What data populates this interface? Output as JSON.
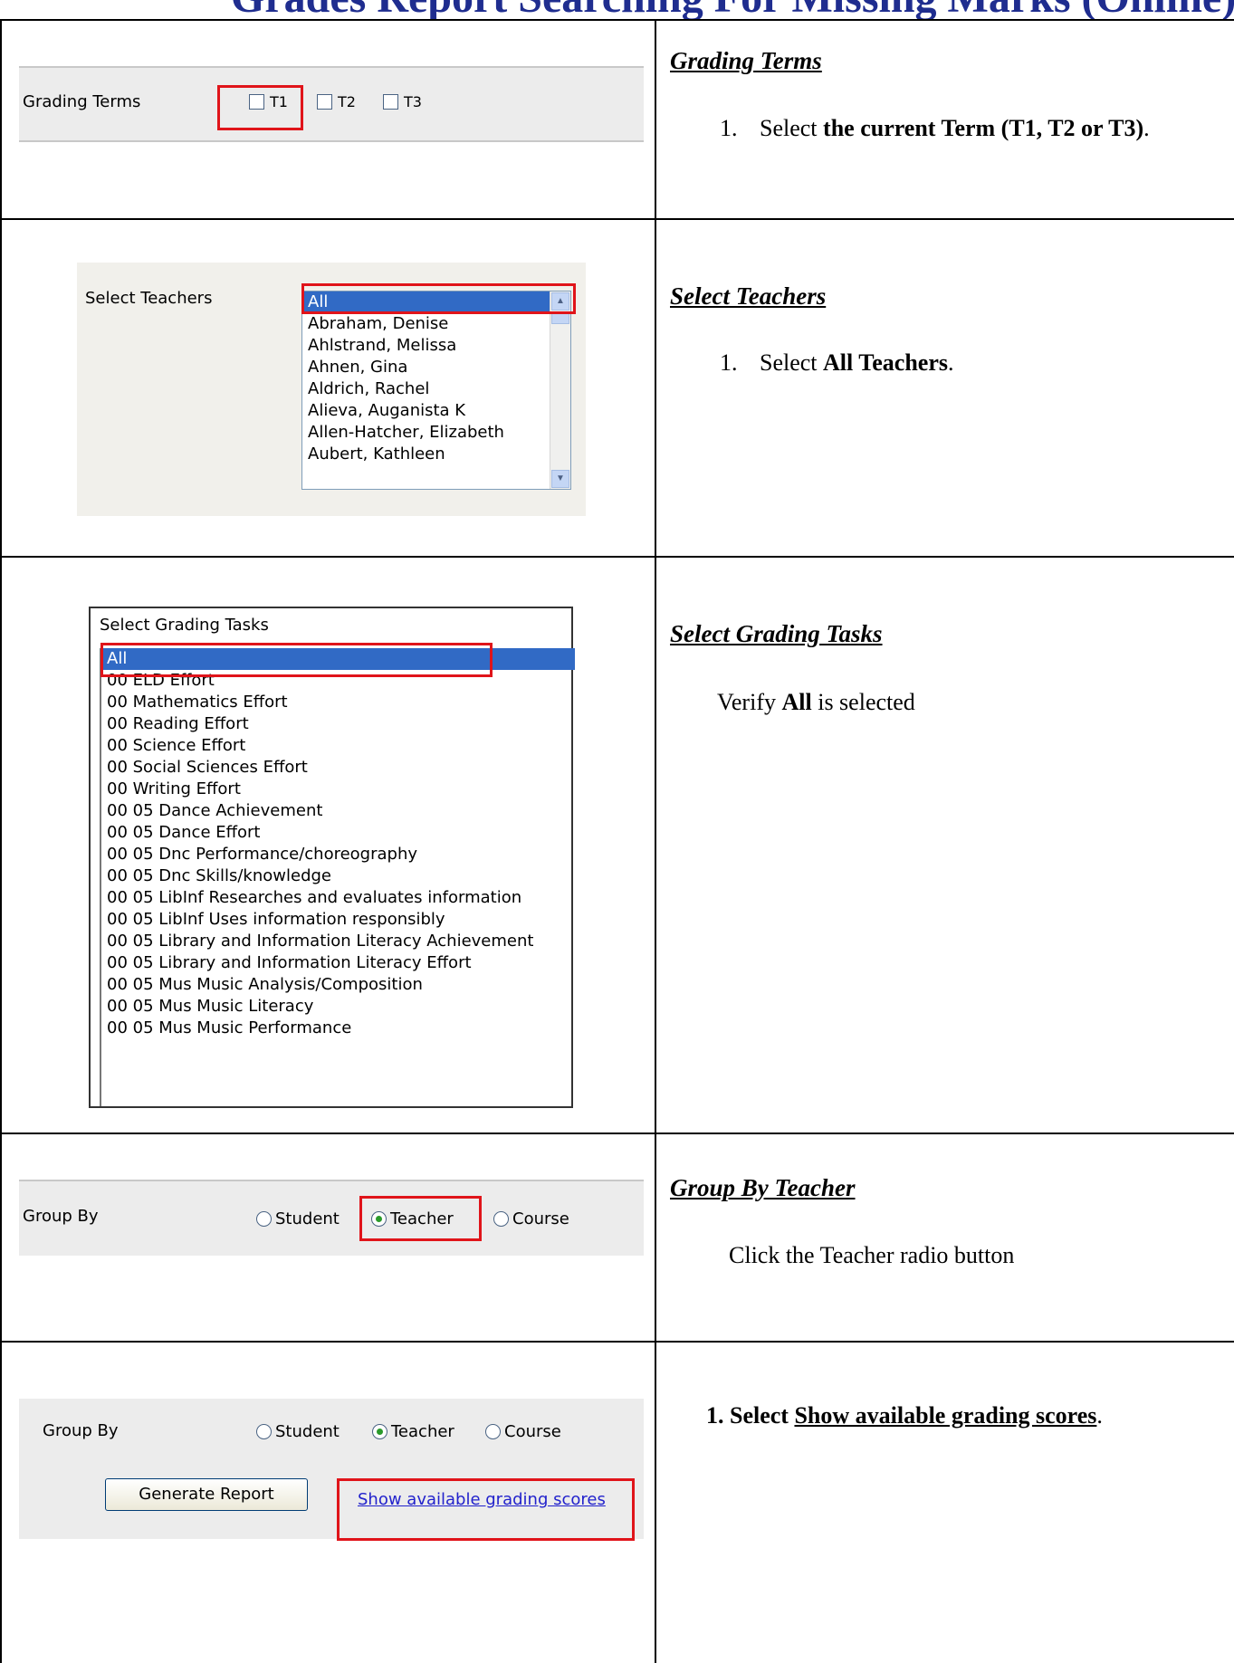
{
  "header": {
    "title": "Grades Report Searching For Missing Marks (Online)"
  },
  "row1": {
    "panel_label": "Grading Terms",
    "terms": [
      "T1",
      "T2",
      "T3"
    ],
    "heading": "Grading Terms",
    "step_number": "1.",
    "step_prefix": "Select ",
    "step_bold": "the current Term (T1, T2 or T3)",
    "step_suffix": "."
  },
  "row2": {
    "panel_label": "Select Teachers",
    "teachers": [
      "All",
      "Abraham, Denise",
      "Ahlstrand, Melissa",
      "Ahnen, Gina",
      "Aldrich, Rachel",
      "Alieva, Auganista K",
      "Allen-Hatcher, Elizabeth",
      "Aubert, Kathleen"
    ],
    "heading": "Select Teachers",
    "step_number": "1.",
    "step_prefix": "Select ",
    "step_bold": "All Teachers",
    "step_suffix": "."
  },
  "row3": {
    "panel_label": "Select Grading Tasks",
    "tasks": [
      "All",
      "00 ELD Effort",
      "00 Mathematics Effort",
      "00 Reading Effort",
      "00 Science Effort",
      "00 Social Sciences Effort",
      "00 Writing Effort",
      "00 05 Dance Achievement",
      "00 05 Dance Effort",
      "00 05 Dnc Performance/choreography",
      "00 05 Dnc Skills/knowledge",
      "00 05 LibInf Researches and evaluates information",
      "00 05 LibInf Uses information responsibly",
      "00 05 Library and Information Literacy Achievement",
      "00 05 Library and Information Literacy Effort",
      "00 05 Mus Music Analysis/Composition",
      "00 05 Mus Music Literacy",
      "00 05 Mus Music Performance"
    ],
    "heading": "Select Grading Tasks",
    "instr_prefix": "Verify ",
    "instr_bold": "All",
    "instr_suffix": " is selected"
  },
  "row4": {
    "panel_label": "Group By",
    "options": [
      "Student",
      "Teacher",
      "Course"
    ],
    "heading": "Group By Teacher",
    "instr": "Click the Teacher radio button"
  },
  "row5": {
    "panel_label": "Group By",
    "options": [
      "Student",
      "Teacher",
      "Course"
    ],
    "button_label": "Generate Report",
    "link_label": "Show available grading scores",
    "step_number": "1.",
    "step_bold": "Select ",
    "step_link": "Show available grading scores",
    "step_suffix": "."
  }
}
